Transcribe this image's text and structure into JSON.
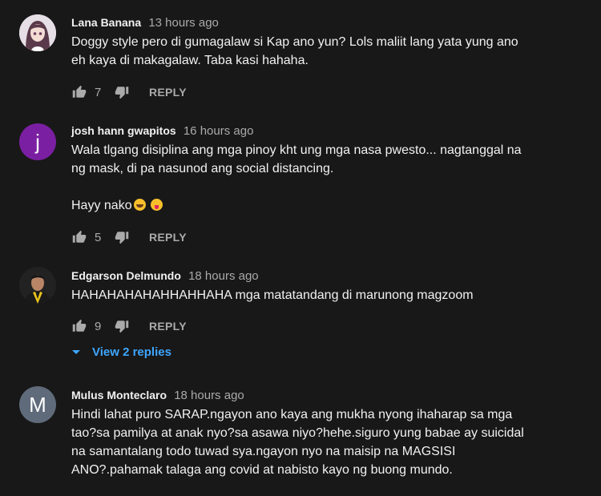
{
  "colors": {
    "background": "#181818",
    "text": "#f1f1f1",
    "muted": "#aaaaaa",
    "link": "#3ea6ff",
    "avatar_j": "#7b1fa2",
    "avatar_m": "#5f6b7a"
  },
  "comments": [
    {
      "author": "Lana Banana",
      "time": "13 hours ago",
      "text": "Doggy style pero di gumagalaw si Kap ano yun? Lols maliit lang yata yung ano\neh kaya di makagalaw. Taba kasi hahaha.",
      "likes": "7",
      "reply_label": "REPLY",
      "avatar_icon": "anime-girl-avatar"
    },
    {
      "author": "josh hann gwapitos",
      "time": "16 hours ago",
      "text": "Wala tlgang disiplina ang mga pinoy kht ung mga nasa pwesto... nagtanggal na\nng mask, di pa nasunod ang social distancing.",
      "text2": " Hayy nako",
      "likes": "5",
      "reply_label": "REPLY",
      "avatar_letter": "j"
    },
    {
      "author": "Edgarson Delmundo",
      "time": "18 hours ago",
      "text": "HAHAHAHAHAHHAHHAHA mga matatandang di marunong magzoom",
      "likes": "9",
      "reply_label": "REPLY",
      "view_replies": "View 2 replies",
      "avatar_icon": "graduate-photo-avatar"
    },
    {
      "author": "Mulus Monteclaro",
      "time": "18 hours ago",
      "text": "Hindi lahat puro SARAP.ngayon ano kaya ang mukha nyong ihaharap sa mga\ntao?sa pamilya at anak nyo?sa asawa niyo?hehe.siguro yung babae ay suicidal\nna samantalang todo tuwad sya.ngayon nyo na maisip na MAGSISI\nANO?.pahamak talaga ang covid at nabisto kayo ng buong mundo.",
      "avatar_letter": "M"
    }
  ]
}
